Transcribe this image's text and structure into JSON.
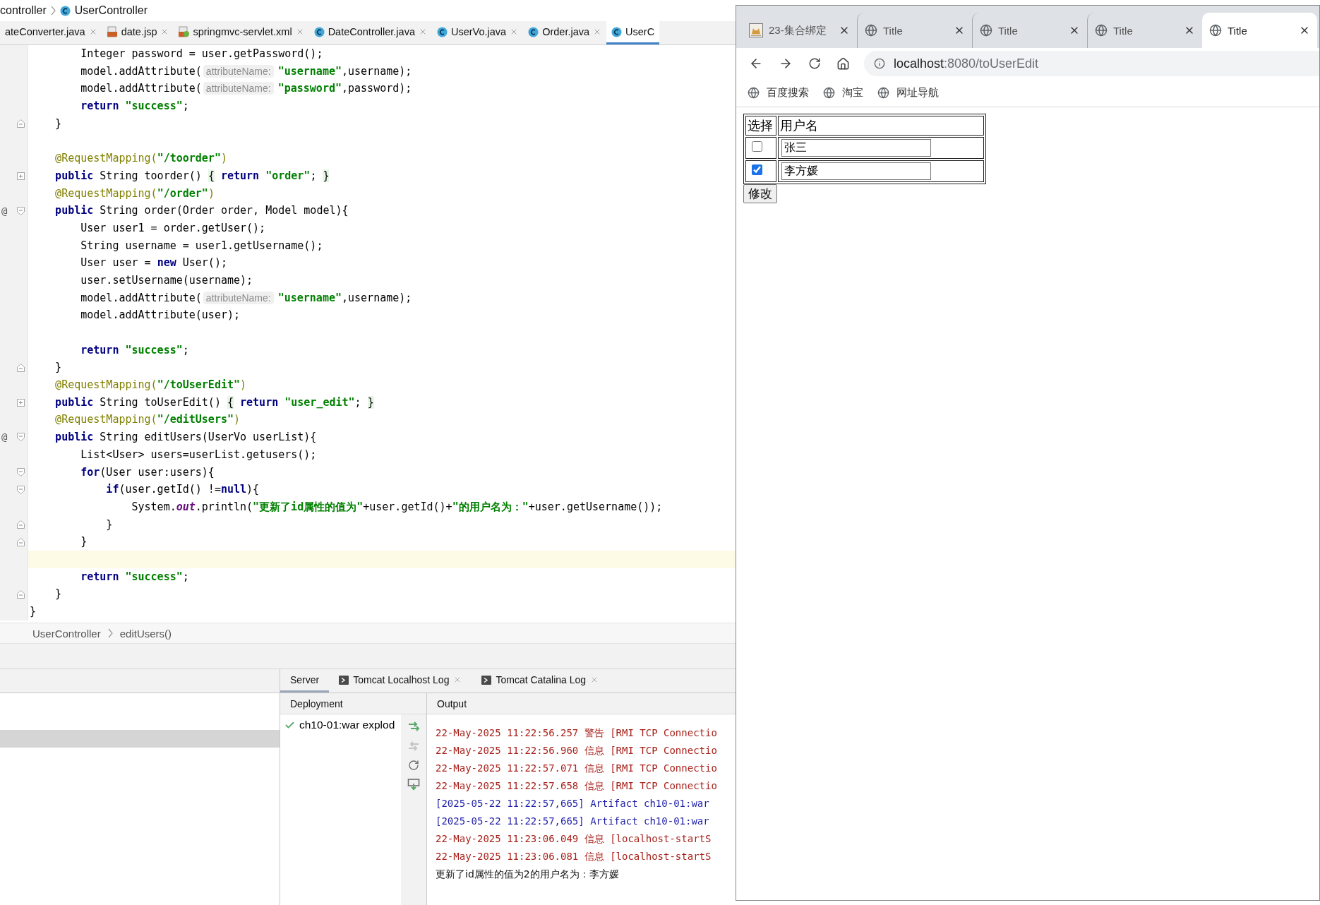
{
  "ide": {
    "breadcrumb": [
      {
        "label": "controller",
        "kind": "package"
      },
      {
        "label": "UserController",
        "kind": "class"
      }
    ],
    "file_tabs": [
      {
        "label": "ateConverter.java",
        "kind": "plain",
        "selected": false
      },
      {
        "label": "date.jsp",
        "kind": "jsp",
        "selected": false
      },
      {
        "label": "springmvc-servlet.xml",
        "kind": "xml",
        "selected": false
      },
      {
        "label": "DateController.java",
        "kind": "class",
        "selected": false
      },
      {
        "label": "UserVo.java",
        "kind": "class",
        "selected": false
      },
      {
        "label": "Order.java",
        "kind": "class",
        "selected": false
      },
      {
        "label": "UserC",
        "kind": "class",
        "selected": true
      }
    ],
    "code_lines": [
      {
        "current": false,
        "tokens": [
          {
            "kind": "plain",
            "text": "        Integer password = user.getPassword();"
          }
        ]
      },
      {
        "current": false,
        "tokens": [
          {
            "kind": "plain",
            "text": "        model.addAttribute("
          },
          {
            "kind": "hint",
            "text": "attributeName:"
          },
          {
            "kind": "str",
            "text": "\"username\""
          },
          {
            "kind": "plain",
            "text": ",username);"
          }
        ]
      },
      {
        "current": false,
        "tokens": [
          {
            "kind": "plain",
            "text": "        model.addAttribute("
          },
          {
            "kind": "hint",
            "text": "attributeName:"
          },
          {
            "kind": "str",
            "text": "\"password\""
          },
          {
            "kind": "plain",
            "text": ",password);"
          }
        ]
      },
      {
        "current": false,
        "tokens": [
          {
            "kind": "kw",
            "text": "        return"
          },
          {
            "kind": "str",
            "text": " \"success\""
          },
          {
            "kind": "plain",
            "text": ";"
          }
        ]
      },
      {
        "current": false,
        "fold": {
          "kind": "end"
        },
        "tokens": [
          {
            "kind": "plain",
            "text": "    }"
          }
        ]
      },
      {
        "current": false
      },
      {
        "current": false,
        "tokens": [
          {
            "kind": "ann",
            "text": "    @RequestMapping("
          },
          {
            "kind": "str",
            "text": "\"/toorder\""
          },
          {
            "kind": "ann",
            "text": ")"
          }
        ]
      },
      {
        "current": false,
        "fold": {
          "kind": "collapsed"
        },
        "tokens": [
          {
            "kind": "kw",
            "text": "    public"
          },
          {
            "kind": "plain",
            "text": " String toorder() "
          },
          {
            "kind": "brace",
            "text": "{"
          },
          {
            "kind": "kw",
            "text": " return"
          },
          {
            "kind": "str",
            "text": " \"order\""
          },
          {
            "kind": "plain",
            "text": "; "
          },
          {
            "kind": "brace",
            "text": "}"
          }
        ]
      },
      {
        "current": false,
        "tokens": [
          {
            "kind": "ann",
            "text": "    @RequestMapping("
          },
          {
            "kind": "str",
            "text": "\"/order\""
          },
          {
            "kind": "ann",
            "text": ")"
          }
        ]
      },
      {
        "current": false,
        "gutter": "@",
        "fold": {
          "kind": "start"
        },
        "tokens": [
          {
            "kind": "kw",
            "text": "    public"
          },
          {
            "kind": "plain",
            "text": " String order(Order order, Model model){"
          }
        ]
      },
      {
        "current": false,
        "tokens": [
          {
            "kind": "plain",
            "text": "        User user1 = order.getUser();"
          }
        ]
      },
      {
        "current": false,
        "tokens": [
          {
            "kind": "plain",
            "text": "        String username = user1.getUsername();"
          }
        ]
      },
      {
        "current": false,
        "tokens": [
          {
            "kind": "plain",
            "text": "        User user = "
          },
          {
            "kind": "kw",
            "text": "new"
          },
          {
            "kind": "plain",
            "text": " User();"
          }
        ]
      },
      {
        "current": false,
        "tokens": [
          {
            "kind": "plain",
            "text": "        user.setUsername(username);"
          }
        ]
      },
      {
        "current": false,
        "tokens": [
          {
            "kind": "plain",
            "text": "        model.addAttribute("
          },
          {
            "kind": "hint",
            "text": "attributeName:"
          },
          {
            "kind": "str",
            "text": "\"username\""
          },
          {
            "kind": "plain",
            "text": ",username);"
          }
        ]
      },
      {
        "current": false,
        "tokens": [
          {
            "kind": "plain",
            "text": "        model.addAttribute(user);"
          }
        ]
      },
      {
        "current": false
      },
      {
        "current": false,
        "tokens": [
          {
            "kind": "kw",
            "text": "        return"
          },
          {
            "kind": "str",
            "text": " \"success\""
          },
          {
            "kind": "plain",
            "text": ";"
          }
        ]
      },
      {
        "current": false,
        "fold": {
          "kind": "end"
        },
        "tokens": [
          {
            "kind": "plain",
            "text": "    }"
          }
        ]
      },
      {
        "current": false,
        "tokens": [
          {
            "kind": "ann",
            "text": "    @RequestMapping("
          },
          {
            "kind": "str",
            "text": "\"/toUserEdit\""
          },
          {
            "kind": "ann",
            "text": ")"
          }
        ]
      },
      {
        "current": false,
        "fold": {
          "kind": "collapsed"
        },
        "tokens": [
          {
            "kind": "kw",
            "text": "    public"
          },
          {
            "kind": "plain",
            "text": " String toUserEdit() "
          },
          {
            "kind": "brace",
            "text": "{"
          },
          {
            "kind": "kw",
            "text": " return"
          },
          {
            "kind": "str",
            "text": " \"user_edit\""
          },
          {
            "kind": "plain",
            "text": "; "
          },
          {
            "kind": "brace",
            "text": "}"
          }
        ]
      },
      {
        "current": false,
        "tokens": [
          {
            "kind": "ann",
            "text": "    @RequestMapping("
          },
          {
            "kind": "str",
            "text": "\"/editUsers\""
          },
          {
            "kind": "ann",
            "text": ")"
          }
        ]
      },
      {
        "current": false,
        "gutter": "@",
        "fold": {
          "kind": "start"
        },
        "tokens": [
          {
            "kind": "kw",
            "text": "    public"
          },
          {
            "kind": "plain",
            "text": " String editUsers(UserVo userList){"
          }
        ]
      },
      {
        "current": false,
        "tokens": [
          {
            "kind": "plain",
            "text": "        List<User> users=userList.getusers();"
          }
        ]
      },
      {
        "current": false,
        "fold": {
          "kind": "start"
        },
        "tokens": [
          {
            "kind": "kw",
            "text": "        for"
          },
          {
            "kind": "plain",
            "text": "(User user:users){"
          }
        ]
      },
      {
        "current": false,
        "fold": {
          "kind": "start"
        },
        "tokens": [
          {
            "kind": "kw",
            "text": "            if"
          },
          {
            "kind": "plain",
            "text": "(user.getId() !="
          },
          {
            "kind": "kw",
            "text": "null"
          },
          {
            "kind": "plain",
            "text": "){"
          }
        ]
      },
      {
        "current": false,
        "tokens": [
          {
            "kind": "plain",
            "text": "                System."
          },
          {
            "kind": "static",
            "text": "out"
          },
          {
            "kind": "plain",
            "text": ".println("
          },
          {
            "kind": "str",
            "text": "\"更新了id属性的值为\""
          },
          {
            "kind": "plain",
            "text": "+user.getId()+"
          },
          {
            "kind": "str",
            "text": "\"的用户名为：\""
          },
          {
            "kind": "plain",
            "text": "+user.getUsername());"
          }
        ]
      },
      {
        "current": false,
        "fold": {
          "kind": "end"
        },
        "tokens": [
          {
            "kind": "plain",
            "text": "            }"
          }
        ]
      },
      {
        "current": false,
        "fold": {
          "kind": "end"
        },
        "tokens": [
          {
            "kind": "plain",
            "text": "        }"
          }
        ]
      },
      {
        "current": true
      },
      {
        "current": false,
        "tokens": [
          {
            "kind": "kw",
            "text": "        return"
          },
          {
            "kind": "str",
            "text": " \"success\""
          },
          {
            "kind": "plain",
            "text": ";"
          }
        ]
      },
      {
        "current": false,
        "fold": {
          "kind": "end"
        },
        "tokens": [
          {
            "kind": "plain",
            "text": "    }"
          }
        ]
      },
      {
        "current": false,
        "tokens": [
          {
            "kind": "plain",
            "text": "}"
          }
        ]
      }
    ],
    "footer_crumbs": [
      "UserController",
      "editUsers()"
    ],
    "tool_tabs": [
      {
        "label": "Server",
        "kind": "plain",
        "closable": false,
        "selected": true
      },
      {
        "label": "Tomcat Localhost Log",
        "kind": "console",
        "closable": true,
        "selected": false
      },
      {
        "label": "Tomcat Catalina Log",
        "kind": "console",
        "closable": true,
        "selected": false
      }
    ],
    "deployment": {
      "header": "Deployment",
      "items": [
        {
          "label": "ch10-01:war explod",
          "deployed": true
        }
      ]
    },
    "output": {
      "header": "Output",
      "lines": [
        {
          "kind": "stderr",
          "text": "22-May-2025 11:22:56.257 警告 [RMI TCP Connectio"
        },
        {
          "kind": "stderr",
          "text": "22-May-2025 11:22:56.960 信息 [RMI TCP Connectio"
        },
        {
          "kind": "stderr",
          "text": "22-May-2025 11:22:57.071 信息 [RMI TCP Connectio"
        },
        {
          "kind": "stderr",
          "text": "22-May-2025 11:22:57.658 信息 [RMI TCP Connectio"
        },
        {
          "kind": "system",
          "text": "[2025-05-22 11:22:57,665] Artifact ch10-01:war"
        },
        {
          "kind": "system",
          "text": "[2025-05-22 11:22:57,665] Artifact ch10-01:war"
        },
        {
          "kind": "stderr",
          "text": "22-May-2025 11:23:06.049 信息 [localhost-startS"
        },
        {
          "kind": "stderr",
          "text": "22-May-2025 11:23:06.081 信息 [localhost-startS"
        },
        {
          "kind": "stdout",
          "text": "更新了id属性的值为2的用户名为：李方媛"
        }
      ]
    }
  },
  "browser": {
    "tabs": [
      {
        "title": "23-集合绑定",
        "kind": "app",
        "selected": false
      },
      {
        "title": "Title",
        "kind": "web",
        "selected": false
      },
      {
        "title": "Title",
        "kind": "web",
        "selected": false
      },
      {
        "title": "Title",
        "kind": "web",
        "selected": false
      },
      {
        "title": "Title",
        "kind": "web",
        "selected": true
      }
    ],
    "address": {
      "host": "localhost",
      "path": ":8080/toUserEdit"
    },
    "bookmarks": [
      "百度搜索",
      "淘宝",
      "网址导航"
    ],
    "table": {
      "columns": [
        "选择",
        "用户名"
      ],
      "rows": [
        {
          "checked": false,
          "value": "张三"
        },
        {
          "checked": true,
          "value": "李方媛"
        }
      ]
    },
    "submit": "修改"
  }
}
